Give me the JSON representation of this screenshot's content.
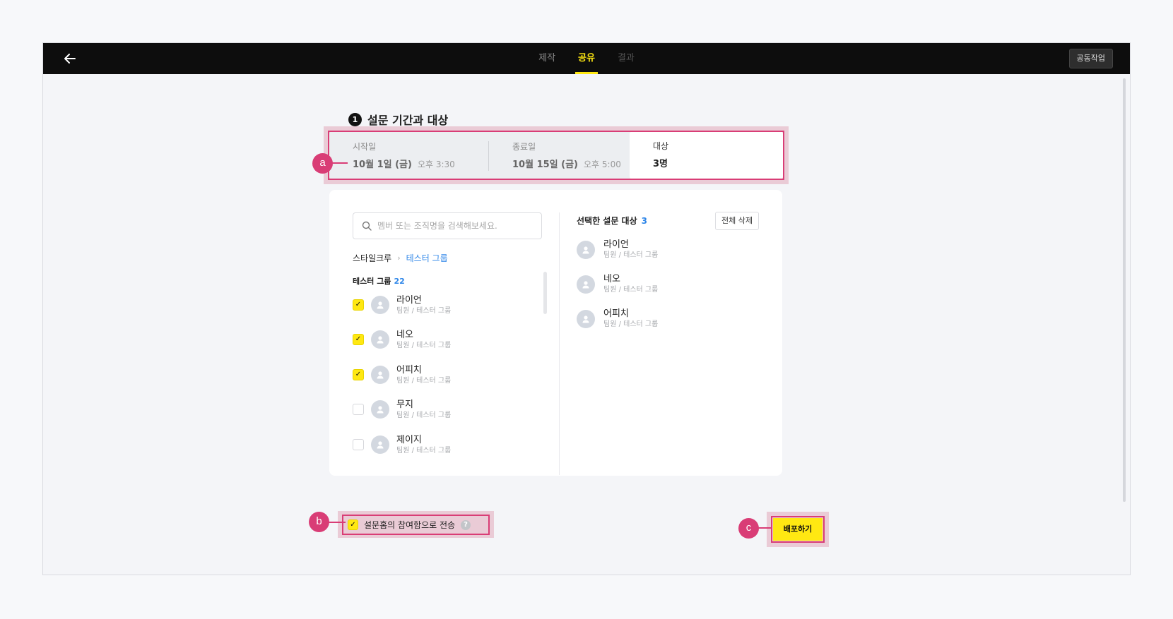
{
  "topbar": {
    "tabs": [
      "제작",
      "공유",
      "결과"
    ],
    "active_tab": "공유",
    "cowork_label": "공동작업"
  },
  "section": {
    "step": "1",
    "title": "설문 기간과 대상"
  },
  "period": {
    "start_label": "시작일",
    "start_date": "10월 1일 (금)",
    "start_time": "오후 3:30",
    "end_label": "종료일",
    "end_date": "10월 15일 (금)",
    "end_time": "오후 5:00",
    "target_label": "대상",
    "target_value": "3명"
  },
  "search": {
    "placeholder": "멤버 또는 조직명을 검색해보세요."
  },
  "breadcrumb": {
    "root": "스타일크루",
    "current": "테스터 그룹"
  },
  "group": {
    "name": "테스터 그룹",
    "count": "22"
  },
  "members": [
    {
      "name": "라이언",
      "sub": "팀원 / 테스터 그룹",
      "checked": true
    },
    {
      "name": "네오",
      "sub": "팀원 / 테스터 그룹",
      "checked": true
    },
    {
      "name": "어피치",
      "sub": "팀원 / 테스터 그룹",
      "checked": true
    },
    {
      "name": "무지",
      "sub": "팀원 / 테스터 그룹",
      "checked": false
    },
    {
      "name": "제이지",
      "sub": "팀원 / 테스터 그룹",
      "checked": false
    }
  ],
  "selected": {
    "title": "선택한 설문 대상",
    "count": "3",
    "clear_label": "전체 삭제",
    "items": [
      {
        "name": "라이언",
        "sub": "팀원 / 테스터 그룹"
      },
      {
        "name": "네오",
        "sub": "팀원 / 테스터 그룹"
      },
      {
        "name": "어피치",
        "sub": "팀원 / 테스터 그룹"
      }
    ]
  },
  "notify": {
    "label": "설문홈의 참여함으로 전송",
    "checked": true,
    "help_icon": "?"
  },
  "deploy_label": "배포하기",
  "annotations": {
    "a": "a",
    "b": "b",
    "c": "c"
  },
  "colors": {
    "accent": "#ffe812",
    "link": "#2e86e8",
    "annotation": "#d93d76"
  }
}
